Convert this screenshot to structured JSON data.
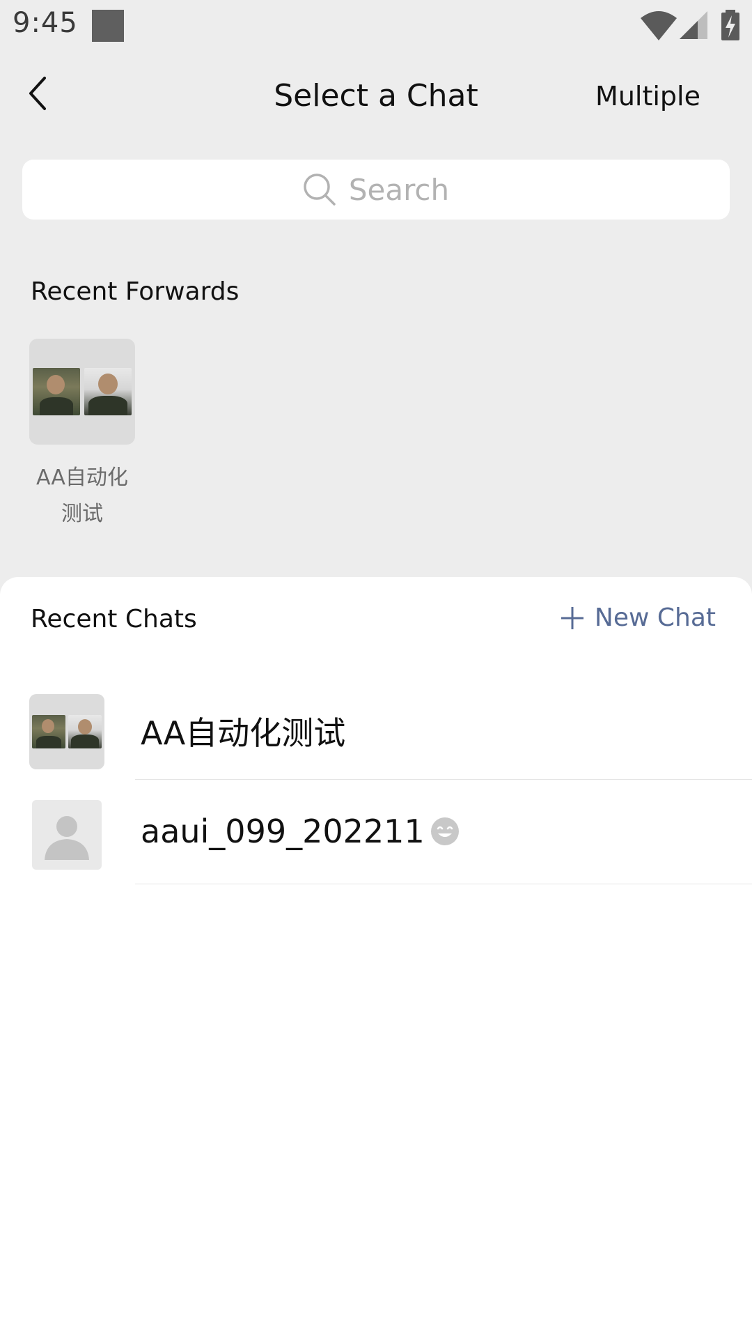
{
  "status_bar": {
    "time": "9:45"
  },
  "header": {
    "title": "Select a Chat",
    "multiple_label": "Multiple"
  },
  "search": {
    "placeholder": "Search"
  },
  "recent_forwards": {
    "title": "Recent Forwards",
    "items": [
      {
        "label_line1": "AA自动化",
        "label_line2": "测试"
      }
    ]
  },
  "recent_chats": {
    "title": "Recent Chats",
    "new_chat_label": "New Chat",
    "items": [
      {
        "name": "AA自动化测试",
        "avatar": "group-avatar"
      },
      {
        "name": "aaui_099_202211",
        "avatar": "default-user-avatar",
        "suffix_icon": "smiley-icon"
      }
    ]
  },
  "colors": {
    "background": "#ededed",
    "panel": "#ffffff",
    "link": "#576b95",
    "placeholder": "#b2b2b2"
  }
}
